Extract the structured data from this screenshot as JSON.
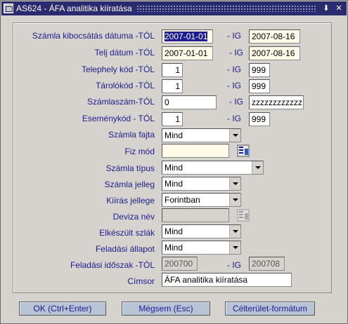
{
  "window": {
    "title": "AS624 - ÁFA analitika kiíratása",
    "minimize_glyph": "⬇",
    "close_glyph": "✕"
  },
  "form": {
    "ig": "- IG",
    "rows": {
      "szamla_date": {
        "label": "Számla kibocsátás dátuma -TÓL",
        "from": "2007-01-01",
        "to": "2007-08-16"
      },
      "telj_date": {
        "label": "Telj dátum -TÓL",
        "from": "2007-01-01",
        "to": "2007-08-16"
      },
      "telephely": {
        "label": "Telephely kód -TÓL",
        "from": "1",
        "to": "999"
      },
      "tarolo": {
        "label": "Tárolókód -TÓL",
        "from": "1",
        "to": "999"
      },
      "szamlaszam": {
        "label": "Számlaszám-TÓL",
        "from": "0",
        "to": "zzzzzzzzzzzz"
      },
      "esemeny": {
        "label": "Eseménykód - TÓL",
        "from": "1",
        "to": "999"
      },
      "szamla_fajta": {
        "label": "Számla fajta",
        "value": "Mind"
      },
      "fiz_mod": {
        "label": "Fiz mód",
        "value": ""
      },
      "szamla_tipus": {
        "label": "Számla típus",
        "value": "Mind"
      },
      "szamla_jelleg": {
        "label": "Számla jelleg",
        "value": "Mind"
      },
      "kiiras_jellege": {
        "label": "Kiírás jellege",
        "value": "Forintban"
      },
      "deviza_nev": {
        "label": "Deviza név",
        "value": ""
      },
      "elkeszult": {
        "label": "Elkészült szlák",
        "value": "Mind"
      },
      "feladasi_allapot": {
        "label": "Feladási állapot",
        "value": "Mind"
      },
      "feladasi_idoszak": {
        "label": "Feladási időszak -TÓL",
        "from": "200700",
        "to": "200708"
      },
      "cimsor": {
        "label": "Címsor",
        "value": "ÁFA analitika kiíratása"
      }
    }
  },
  "buttons": {
    "ok": "OK (Ctrl+Enter)",
    "cancel": "Mégsem (Esc)",
    "target": "Célterület-formátum"
  }
}
